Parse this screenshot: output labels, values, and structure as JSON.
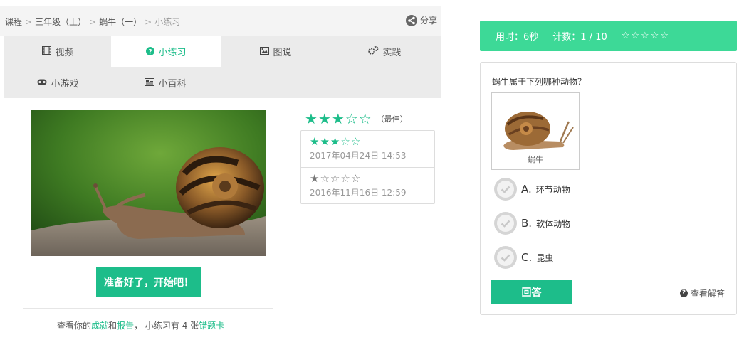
{
  "breadcrumb": {
    "items": [
      "课程",
      "三年级（上）",
      "蜗牛（一）"
    ],
    "separator": ">",
    "current": "小练习"
  },
  "share": {
    "label": "分享",
    "icon": "share-icon"
  },
  "tabs": [
    {
      "label": "视频",
      "icon": "film-icon"
    },
    {
      "label": "小练习",
      "icon": "question-circle-icon",
      "active": true
    },
    {
      "label": "图说",
      "icon": "image-icon"
    },
    {
      "label": "实践",
      "icon": "gears-icon"
    },
    {
      "label": "小游戏",
      "icon": "gamepad-icon"
    },
    {
      "label": "小百科",
      "icon": "newspaper-icon"
    }
  ],
  "start_button": "准备好了，开始吧！",
  "info": {
    "prefix": "查看你的",
    "achievements": "成就",
    "and": "和",
    "report": "报告",
    "middle": "， 小练习有 4 张",
    "wrong_cards": "错题卡"
  },
  "best": {
    "stars": "★★★☆☆",
    "rating": 3,
    "label": "（最佳）"
  },
  "history": [
    {
      "stars": "★★★☆☆",
      "rating": 3,
      "date": "2017年04月24日 14:53"
    },
    {
      "stars": "★☆☆☆☆",
      "rating": 1,
      "date": "2016年11月16日 12:59"
    }
  ],
  "status": {
    "time": "用时：6秒",
    "count": "计数：1 / 10",
    "stars": "☆☆☆☆☆"
  },
  "question": {
    "text": "蜗牛属于下列哪种动物？",
    "image_caption": "蜗牛",
    "options": [
      {
        "letter": "A.",
        "text": "环节动物"
      },
      {
        "letter": "B.",
        "text": "软体动物"
      },
      {
        "letter": "C.",
        "text": "昆虫"
      }
    ],
    "answer_button": "回答",
    "explain_link": "查看解答"
  },
  "colors": {
    "accent": "#1dbd8a",
    "status_bar": "#3dd997"
  }
}
